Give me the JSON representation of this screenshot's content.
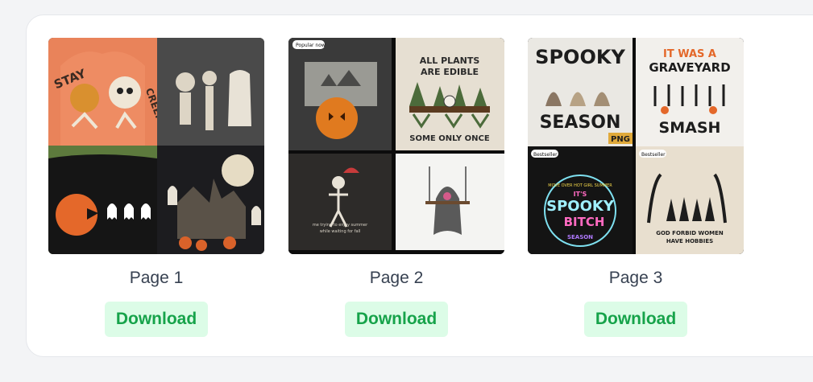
{
  "colors": {
    "page_bg": "#f3f4f6",
    "button_bg": "#dcfce7",
    "button_text": "#16a34a",
    "caption_text": "#374151"
  },
  "pages": [
    {
      "caption": "Page 1",
      "download_label": "Download",
      "image_text": {
        "stay": "STAY",
        "creepy": "CREEPY"
      }
    },
    {
      "caption": "Page 2",
      "download_label": "Download",
      "image_text": {
        "badge": "Popular now",
        "plants_line1": "ALL PLANTS",
        "plants_line2": "ARE EDIBLE",
        "plants_line3": "SOME ONLY ONCE",
        "summer_line1": "me trying to enjoy summer",
        "summer_line2": "while waiting for fall"
      }
    },
    {
      "caption": "Page 3",
      "download_label": "Download",
      "image_text": {
        "spooky": "SPOOKY",
        "season": "SEASON",
        "png": "PNG",
        "graveyard_line1": "IT WAS A",
        "graveyard_line2": "GRAVEYARD",
        "graveyard_line3": "SMASH",
        "bestseller_left": "Bestseller",
        "bestseller_right": "Bestseller",
        "neon_line1": "MOVE OVER HOT GIRL SUMMER",
        "neon_line2": "IT'S",
        "neon_line3": "SPOOKY",
        "neon_line4": "BITCH",
        "neon_line5": "SEASON",
        "witches_line1": "GOD FORBID WOMEN",
        "witches_line2": "HAVE HOBBIES"
      }
    }
  ]
}
